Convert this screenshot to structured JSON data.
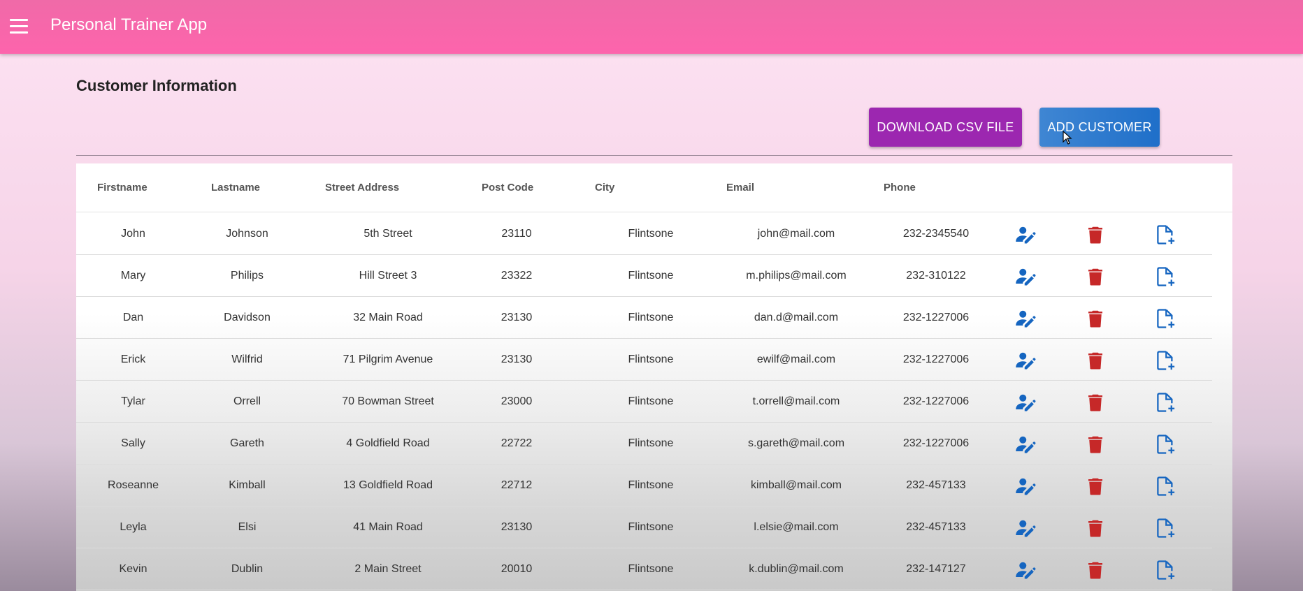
{
  "app": {
    "title": "Personal Trainer App"
  },
  "page": {
    "title": "Customer Information"
  },
  "toolbar": {
    "download_label": "DOWNLOAD CSV FILE",
    "add_label": "ADD CUSTOMER"
  },
  "colors": {
    "appbar": "#fd64ac",
    "download_button": "#9c27b0",
    "add_button": "#1f6fc9",
    "edit_icon": "#1565c0",
    "delete_icon": "#c62828"
  },
  "icons": {
    "menu": "menu-icon",
    "edit": "edit-person-icon",
    "delete": "trash-icon",
    "add_training": "note-add-icon"
  },
  "table": {
    "headers": [
      "Firstname",
      "Lastname",
      "Street Address",
      "Post Code",
      "City",
      "Email",
      "Phone"
    ],
    "rows": [
      [
        "John",
        "Johnson",
        "5th Street",
        "23110",
        "Flintsone",
        "john@mail.com",
        "232-2345540"
      ],
      [
        "Mary",
        "Philips",
        "Hill Street 3",
        "23322",
        "Flintsone",
        "m.philips@mail.com",
        "232-310122"
      ],
      [
        "Dan",
        "Davidson",
        "32 Main Road",
        "23130",
        "Flintsone",
        "dan.d@mail.com",
        "232-1227006"
      ],
      [
        "Erick",
        "Wilfrid",
        "71 Pilgrim Avenue",
        "23130",
        "Flintsone",
        "ewilf@mail.com",
        "232-1227006"
      ],
      [
        "Tylar",
        "Orrell",
        "70 Bowman Street",
        "23000",
        "Flintsone",
        "t.orrell@mail.com",
        "232-1227006"
      ],
      [
        "Sally",
        "Gareth",
        "4 Goldfield Road",
        "22722",
        "Flintsone",
        "s.gareth@mail.com",
        "232-1227006"
      ],
      [
        "Roseanne",
        "Kimball",
        "13 Goldfield Road",
        "22712",
        "Flintsone",
        "kimball@mail.com",
        "232-457133"
      ],
      [
        "Leyla",
        "Elsi",
        "41 Main Road",
        "23130",
        "Flintsone",
        "l.elsie@mail.com",
        "232-457133"
      ],
      [
        "Kevin",
        "Dublin",
        "2 Main Street",
        "20010",
        "Flintsone",
        "k.dublin@mail.com",
        "232-147127"
      ]
    ]
  }
}
